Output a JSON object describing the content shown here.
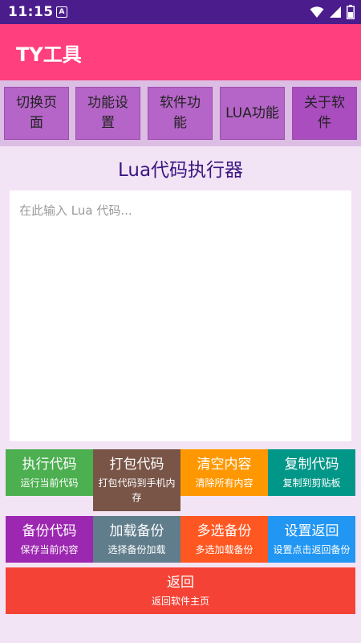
{
  "status": {
    "time": "11:15",
    "notification": "A"
  },
  "appbar": {
    "title": "TY工具"
  },
  "nav": [
    {
      "label": "切换页面"
    },
    {
      "label": "功能设置"
    },
    {
      "label": "软件功能"
    },
    {
      "label": "LUA功能"
    },
    {
      "label": "关于软件"
    }
  ],
  "heading": "Lua代码执行器",
  "editor": {
    "placeholder": "在此输入 Lua 代码...",
    "value": ""
  },
  "actions": [
    {
      "label": "执行代码",
      "sub": "运行当前代码",
      "color": "#4caf50"
    },
    {
      "label": "打包代码",
      "sub": "打包代码到手机内存",
      "color": "#795548"
    },
    {
      "label": "清空内容",
      "sub": "清除所有内容",
      "color": "#ff9800"
    },
    {
      "label": "复制代码",
      "sub": "复制到剪贴板",
      "color": "#009688"
    },
    {
      "label": "备份代码",
      "sub": "保存当前内容",
      "color": "#9c27b0"
    },
    {
      "label": "加载备份",
      "sub": "选择备份加载",
      "color": "#607d8b"
    },
    {
      "label": "多选备份",
      "sub": "多选加载备份",
      "color": "#ff5722"
    },
    {
      "label": "设置返回",
      "sub": "设置点击返回备份",
      "color": "#2196f3"
    },
    {
      "label": "返回",
      "sub": "返回软件主页",
      "color": "#f44336"
    }
  ]
}
